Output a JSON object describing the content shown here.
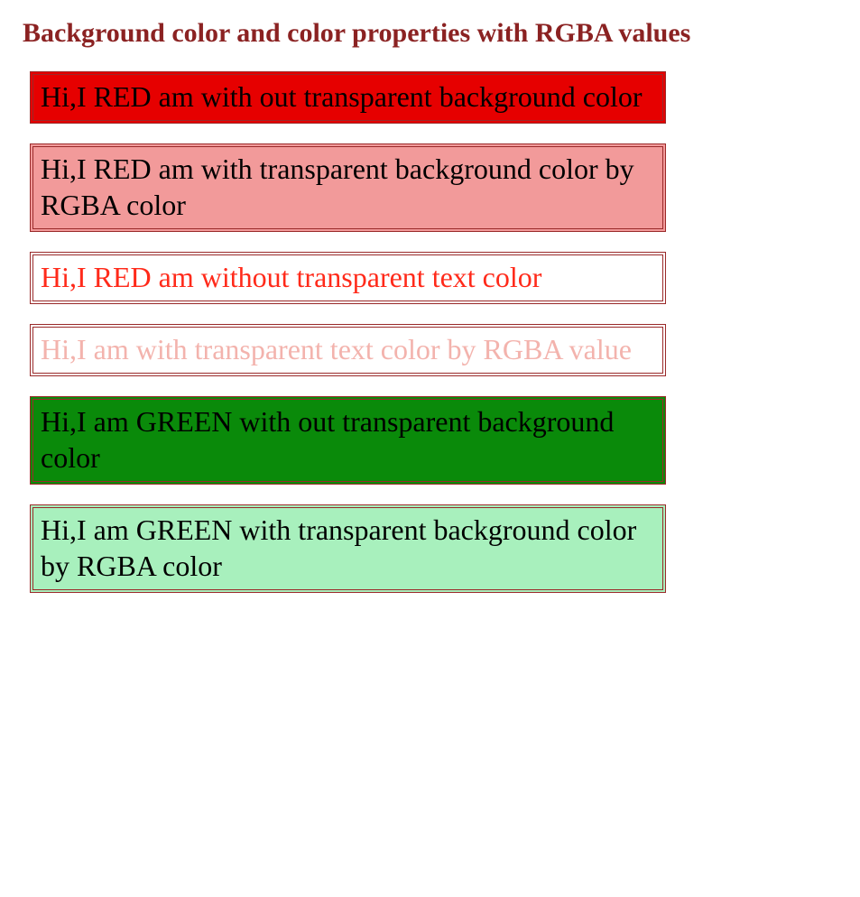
{
  "title": "Background color and color properties with RGBA values",
  "boxes": [
    {
      "text": "Hi,I RED am with out transparent background color"
    },
    {
      "text": "Hi,I RED am with transparent background color by RGBA color"
    },
    {
      "text": "Hi,I RED am without transparent text color"
    },
    {
      "text": "Hi,I am with transparent text color by RGBA value"
    },
    {
      "text": "Hi,I am GREEN with out transparent background color"
    },
    {
      "text": "Hi,I am GREEN with transparent background color by RGBA color"
    }
  ]
}
